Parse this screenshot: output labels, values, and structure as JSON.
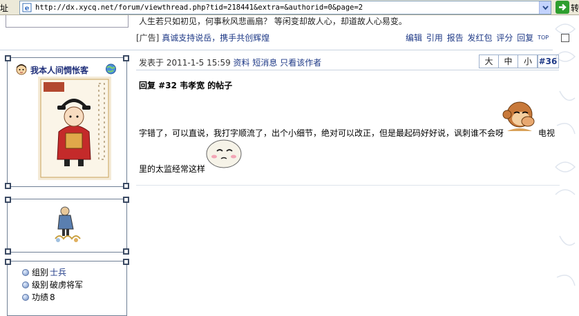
{
  "browser": {
    "address_label": "址",
    "url": "http://dx.xycq.net/forum/viewthread.php?tid=218441&extra=&authorid=0&page=2",
    "go_label": "转"
  },
  "prev_post": {
    "signature_text": "人生若只如初见，何事秋风悲画扇？ 等闲变却故人心，却道故人心易变。",
    "ad_prefix": "[广告]",
    "ad_link": "真诚支持说岳，携手共创辉煌",
    "actions": [
      "编辑",
      "引用",
      "报告",
      "发红包",
      "评分",
      "回复"
    ],
    "top_label": "TOP"
  },
  "author": {
    "username": "我本人间惆怅客",
    "stats": [
      {
        "label": "组别",
        "value": "士兵",
        "link": true
      },
      {
        "label": "级别",
        "value": "破虏将军",
        "link": false
      },
      {
        "label": "功绩",
        "value": "8",
        "link": false
      }
    ]
  },
  "post": {
    "posted_prefix": "发表于",
    "datetime": "2011-1-5 15:59",
    "links": [
      "资料",
      "短消息",
      "只看该作者"
    ],
    "font_sizes": [
      "大",
      "中",
      "小"
    ],
    "floor": "#36",
    "title": "回复 #32 韦孝宽 的帖子",
    "body_line1": "字错了，可以直说，我打字顺流了，出个小细节，绝对可以改正，但是最起码好好说，讽刺谁不会呀",
    "body_line1_end": "电视",
    "body_line2": "里的太监经常这样"
  },
  "icons": {
    "ie": "ie-page-icon",
    "dropdown": "chevron-down-icon",
    "go": "go-arrow-icon",
    "user_face": "user-face-icon",
    "online": "globe-online-icon",
    "monkey": "monkey-emoticon",
    "bun": "bun-emoticon"
  },
  "colors": {
    "link": "#1f3a87",
    "border": "#6f7f95",
    "divider": "#c9d3e0"
  }
}
